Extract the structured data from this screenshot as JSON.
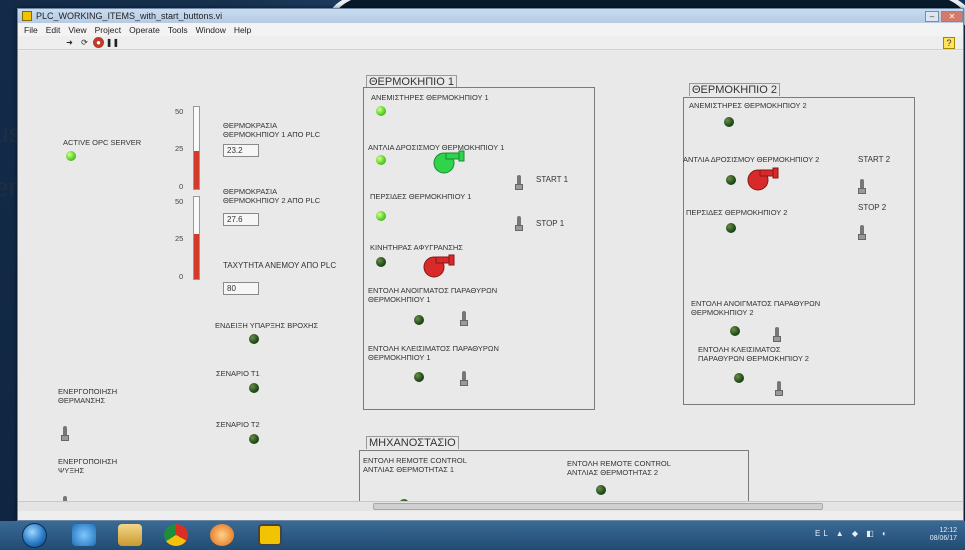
{
  "window": {
    "title": "PLC_WORKING_ITEMS_with_start_buttons.vi",
    "help_glyph": "?"
  },
  "menu": [
    "File",
    "Edit",
    "View",
    "Project",
    "Operate",
    "Tools",
    "Window",
    "Help"
  ],
  "toolbar_icons": [
    "run-arrow-icon",
    "run-continuous-icon",
    "abort-icon",
    "pause-icon"
  ],
  "background_text": [
    "us",
    "er"
  ],
  "left": {
    "opc_label": "ACTIVE OPC SERVER",
    "temp1_label": "ΘΕΡΜΟΚΡΑΣΙΑ\nΘΕΡΜΟΚΗΠΙΟΥ 1 ΑΠΟ PLC",
    "temp1_value": "23.2",
    "temp2_label": "ΘΕΡΜΟΚΡΑΣΙΑ\nΘΕΡΜΟΚΗΠΙΟΥ 2 ΑΠΟ PLC",
    "temp2_value": "27.6",
    "wind_label": "ΤΑΧΥΤΗΤΑ ΑΝΕΜΟΥ ΑΠΟ PLC",
    "wind_value": "80",
    "rain_label": "ΕΝΔΕΙΞΗ ΥΠΑΡΞΗΣ ΒΡΟΧΗΣ",
    "scenario1_label": "ΣΕΝΑΡΙΟ Τ1",
    "scenario2_label": "ΣΕΝΑΡΙΟ Τ2",
    "heating_label": "ΕΝΕΡΓΟΠΟΙΗΣΗ\nΘΕΡΜΑΝΣΗΣ",
    "cooling_label": "ΕΝΕΡΓΟΠΟΙΗΣΗ\nΨΥΞΗΣ",
    "thermo1_ticks": [
      "50",
      "25",
      "0"
    ],
    "thermo2_ticks": [
      "50",
      "25",
      "0"
    ],
    "thermo1_level": 0.46,
    "thermo2_level": 0.55
  },
  "greenhouse1": {
    "title": "ΘΕΡΜΟΚΗΠΙΟ 1",
    "fans_label": "ΑΝΕΜΙΣΤΗΡΕΣ ΘΕΡΜΟΚΗΠΙΟΥ 1",
    "pump_label": "ΑΝΤΛΙΑ ΔΡΟΣΙΣΜΟΥ ΘΕΡΜΟΚΗΠΙΟΥ 1",
    "start_label": "START 1",
    "stop_label": "STOP 1",
    "curtains_label": "ΠΕΡΣΙΔΕΣ ΘΕΡΜΟΚΗΠΙΟΥ 1",
    "dehum_label": "ΚΙΝΗΤΗΡΑΣ ΑΦΥΓΡΑΝΣΗΣ",
    "open_label": "ΕΝΤΟΛΗ ΑΝΟΙΓΜΑΤΟΣ ΠΑΡΑΘΥΡΩΝ\nΘΕΡΜΟΚΗΠΙΟΥ 1",
    "close_label": "ΕΝΤΟΛΗ ΚΛΕΙΣΙΜΑΤΟΣ ΠΑΡΑΘΥΡΩΝ\nΘΕΡΜΟΚΗΠΙΟΥ 1"
  },
  "greenhouse2": {
    "title": "ΘΕΡΜΟΚΗΠΙΟ 2",
    "fans_label": "ΑΝΕΜΙΣΤΗΡΕΣ ΘΕΡΜΟΚΗΠΙΟΥ 2",
    "pump_label": "ΑΝΤΛΙΑ ΔΡΟΣΙΣΜΟΥ ΘΕΡΜΟΚΗΠΙΟΥ 2",
    "start_label": "START 2",
    "stop_label": "STOP 2",
    "curtains_label": "ΠΕΡΣΙΔΕΣ ΘΕΡΜΟΚΗΠΙΟΥ 2",
    "open_label": "ΕΝΤΟΛΗ ΑΝΟΙΓΜΑΤΟΣ ΠΑΡΑΘΥΡΩΝ\nΘΕΡΜΟΚΗΠΙΟΥ 2",
    "close_label": "ΕΝΤΟΛΗ ΚΛΕΙΣΙΜΑΤΟΣ\nΠΑΡΑΘΥΡΩΝ ΘΕΡΜΟΚΗΠΙΟΥ 2"
  },
  "engine_room": {
    "title": "ΜΗΧΑΝΟΣΤΑΣΙΟ",
    "remote1_label": "ΕΝΤΟΛΗ REMOTE CONTROL\nΑΝΤΛΙΑΣ ΘΕΡΜΟΤΗΤΑΣ 1",
    "remote2_label": "ΕΝΤΟΛΗ REMOTE CONTROL\nΑΝΤΛΙΑΣ ΘΕΡΜΟΤΗΤΑΣ 2"
  },
  "taskbar": {
    "apps": [
      "start-orb-icon",
      "ie-icon",
      "explorer-icon",
      "chrome-icon",
      "media-player-icon",
      "labview-icon"
    ],
    "time": "12:12",
    "date": "08/06/17",
    "lang": "EL"
  },
  "colors": {
    "led_on": "#5dd22a",
    "led_off": "#1f4a18",
    "pump_on": "#2fd44c",
    "pump_off": "#d82a2a",
    "thermo_fill": "#d23a2a"
  }
}
